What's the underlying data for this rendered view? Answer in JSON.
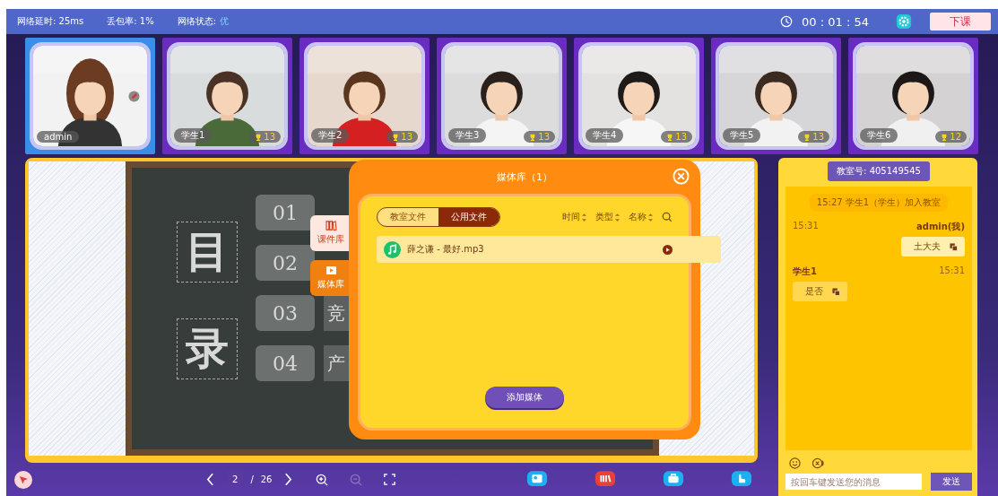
{
  "status_bar": {
    "latency": "网络延时: 25ms",
    "loss": "丢包率: 1%",
    "state_label": "网络状态:",
    "state_value": "优"
  },
  "timer": "00 : 01 : 54",
  "end_button": "下课",
  "videos": [
    {
      "name": "admin",
      "selected": true,
      "pen": true
    },
    {
      "name": "学生1",
      "selected": false,
      "pen": false,
      "trophies": "13"
    },
    {
      "name": "学生2",
      "selected": false,
      "pen": false,
      "trophies": "13"
    },
    {
      "name": "学生3",
      "selected": false,
      "pen": false,
      "trophies": "13"
    },
    {
      "name": "学生4",
      "selected": false,
      "pen": false,
      "trophies": "13"
    },
    {
      "name": "学生5",
      "selected": false,
      "pen": false,
      "trophies": "13"
    },
    {
      "name": "学生6",
      "selected": false,
      "pen": false,
      "trophies": "12"
    }
  ],
  "slide": {
    "chars": [
      "目",
      "录"
    ],
    "items": [
      {
        "num": "01"
      },
      {
        "num": "02"
      },
      {
        "num": "03",
        "label": "竞"
      },
      {
        "num": "04",
        "label": "产"
      }
    ]
  },
  "side_tabs": [
    {
      "label": "课件库",
      "selected": false
    },
    {
      "label": "媒体库",
      "selected": true
    }
  ],
  "dialog": {
    "title": "媒体库（1）",
    "tabs": [
      {
        "label": "教室文件",
        "selected": false
      },
      {
        "label": "公用文件",
        "selected": true
      }
    ],
    "sort": [
      "时间",
      "类型",
      "名称"
    ],
    "files": [
      {
        "name": "薛之谦 - 最好.mp3"
      }
    ],
    "add_button": "添加媒体"
  },
  "pager": {
    "page": "2",
    "separator": "/",
    "total": "26",
    "zoom_out_disabled": true
  },
  "chat": {
    "room": "教室号: 405149545",
    "notice": "15:27  学生1（学生）加入教室",
    "messages": [
      {
        "sender": "admin(我)",
        "time": "15:31",
        "text": "土大夫",
        "mine": true
      },
      {
        "sender": "学生1",
        "time": "15:31",
        "text": "是否",
        "mine": false
      }
    ],
    "placeholder": "按回车键发送您的消息",
    "send": "发送"
  }
}
